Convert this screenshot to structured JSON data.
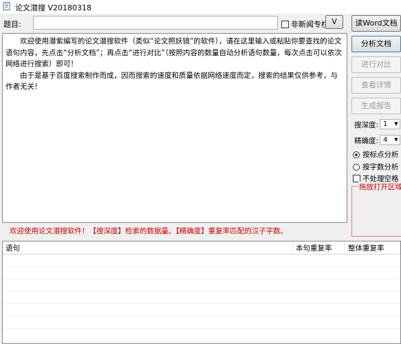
{
  "window": {
    "title": "论文潜搜 V20180318"
  },
  "form": {
    "subject_label": "题目:",
    "subject_value": "",
    "checkbox_label": "非新闻专栏",
    "dropdown_label": "V"
  },
  "content": {
    "paragraph1": "欢迎使用潜紫编写的论文潜搜软件（类似“论文照妖镜”的软件），请在这里输入或粘贴你要查找的论文语句内容，先点击“分析文档”；再点击“进行对比”（按照内容的数量自动分析语句数量，每次点击可以依次网络进行搜索）即可！",
    "paragraph2": "由于是基于百度搜索制作而成，因而搜索的速度和质量依据网络速度而定，搜索的结果仅供参考，与作者无关！"
  },
  "status": {
    "text": "欢迎使用论文潜搜软件！【搜深度】检索的数据量。【精确度】重复率匹配的汉子字数。"
  },
  "table": {
    "columns": [
      "语句",
      "本句重复率",
      "整体重复率"
    ]
  },
  "sidebar": {
    "btn_read_word": "读Word文档",
    "btn_analyze": "分析文档",
    "btn_compare": "进行对比",
    "btn_details": "查看详情",
    "btn_report": "生成报告",
    "depth_label": "搜深度:",
    "depth_value": "1",
    "precision_label": "精确度:",
    "precision_value": "4",
    "radio_punct": "按标点分析",
    "radio_chars": "按字数分析",
    "no_space_label": "不处理空格",
    "drop_area_label": "拖放打开区域"
  },
  "colors": {
    "status_red": "#d00000",
    "accent_blue": "#1a3f8a"
  }
}
